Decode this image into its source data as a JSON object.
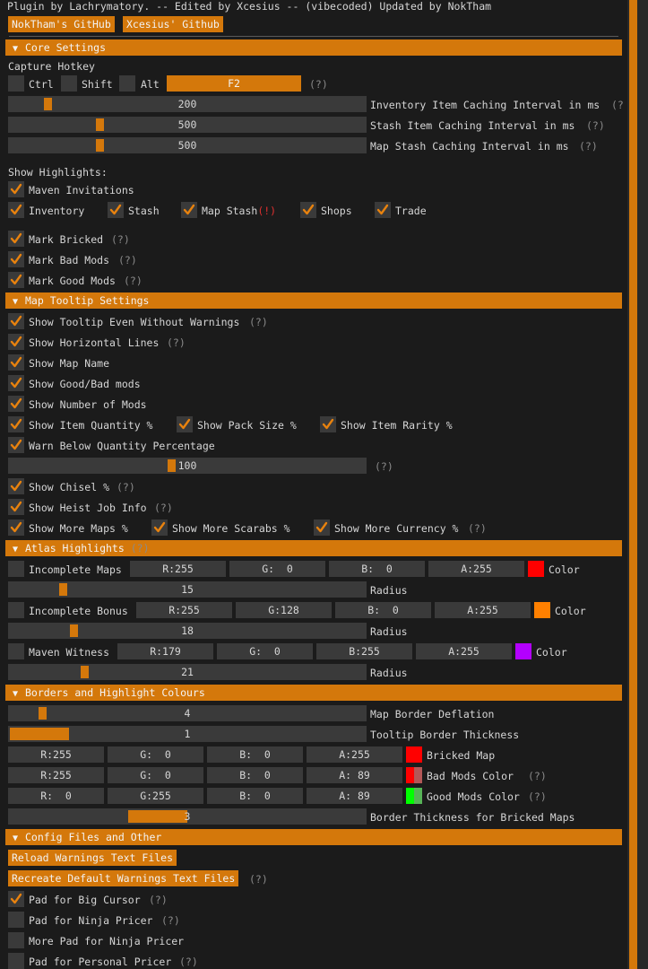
{
  "header_text": "Plugin by Lachrymatory. -- Edited by Xcesius -- (vibecoded) Updated by NokTham",
  "links": {
    "nok": "NokTham's GitHub",
    "xce": "Xcesius' Github"
  },
  "help": "(?)",
  "sections": {
    "core": "Core Settings",
    "map_tooltip": "Map Tooltip Settings",
    "atlas": "Atlas Highlights",
    "borders": "Borders and Highlight Colours",
    "config": "Config Files and Other"
  },
  "core": {
    "capture_hotkey": "Capture Hotkey",
    "ctrl": "Ctrl",
    "shift": "Shift",
    "alt": "Alt",
    "hotkey_value": "F2",
    "inv_cache": {
      "value": "200",
      "label": "Inventory Item Caching Interval in ms",
      "help": "(?"
    },
    "stash_cache": {
      "value": "500",
      "label": "Stash Item Caching Interval in ms"
    },
    "mapstash_cache": {
      "value": "500",
      "label": "Map Stash Caching Interval in ms"
    },
    "show_highlights": "Show Highlights:",
    "maven_invitations": "Maven Invitations",
    "inventory": "Inventory",
    "stash": "Stash",
    "map_stash": "Map Stash",
    "map_stash_warn": "(!)",
    "shops": "Shops",
    "trade": "Trade",
    "mark_bricked": "Mark Bricked",
    "mark_bad": "Mark Bad Mods",
    "mark_good": "Mark Good Mods"
  },
  "tooltip": {
    "even_without": "Show Tooltip Even Without Warnings",
    "horizontal": "Show Horizontal Lines",
    "map_name": "Show Map Name",
    "good_bad": "Show Good/Bad mods",
    "num_mods": "Show Number of Mods",
    "item_qty": "Show Item Quantity %",
    "pack_size": "Show Pack Size %",
    "item_rarity": "Show Item Rarity %",
    "warn_below": "Warn Below Quantity Percentage",
    "warn_value": "100",
    "chisel": "Show Chisel %",
    "heist": "Show Heist Job Info",
    "more_maps": "Show More Maps %",
    "more_scarabs": "Show More Scarabs %",
    "more_currency": "Show More Currency %"
  },
  "atlas": {
    "incomplete_maps": {
      "label": "Incomplete Maps",
      "r": "R:255",
      "g": "G:  0",
      "b": "B:  0",
      "a": "A:255",
      "color": "#ff0000",
      "color_label": "Color",
      "radius": "15",
      "radius_label": "Radius"
    },
    "incomplete_bonus": {
      "label": "Incomplete Bonus",
      "r": "R:255",
      "g": "G:128",
      "b": "B:  0",
      "a": "A:255",
      "color": "#ff8000",
      "color_label": "Color",
      "radius": "18",
      "radius_label": "Radius"
    },
    "maven_witness": {
      "label": "Maven Witness",
      "r": "R:179",
      "g": "G:  0",
      "b": "B:255",
      "a": "A:255",
      "color": "#b300ff",
      "color_label": "Color",
      "radius": "21",
      "radius_label": "Radius"
    }
  },
  "borders": {
    "deflation": {
      "value": "4",
      "label": "Map Border Deflation"
    },
    "thickness": {
      "value": "1",
      "label": "Tooltip Border Thickness"
    },
    "bricked": {
      "r": "R:255",
      "g": "G:  0",
      "b": "B:  0",
      "a": "A:255",
      "color": "#ff0000",
      "label": "Bricked Map"
    },
    "bad": {
      "r": "R:255",
      "g": "G:  0",
      "b": "B:  0",
      "a": "A: 89",
      "color": "#ff0000",
      "label": "Bad Mods Color"
    },
    "good": {
      "r": "R:  0",
      "g": "G:255",
      "b": "B:  0",
      "a": "A: 89",
      "color": "#00ff00",
      "label": "Good Mods Color"
    },
    "bricked_thickness": {
      "value": "3",
      "label": "Border Thickness for Bricked Maps"
    }
  },
  "config": {
    "reload": "Reload Warnings Text Files",
    "recreate": "Recreate Default Warnings Text Files",
    "pad_big_cursor": "Pad for Big Cursor",
    "pad_ninja": "Pad for Ninja Pricer",
    "more_pad_ninja": "More Pad for Ninja Pricer",
    "pad_personal": "Pad for Personal Pricer"
  },
  "colors": {
    "accent": "#d4780b",
    "frame": "#3a3a3a",
    "background": "#1b1b1b"
  }
}
